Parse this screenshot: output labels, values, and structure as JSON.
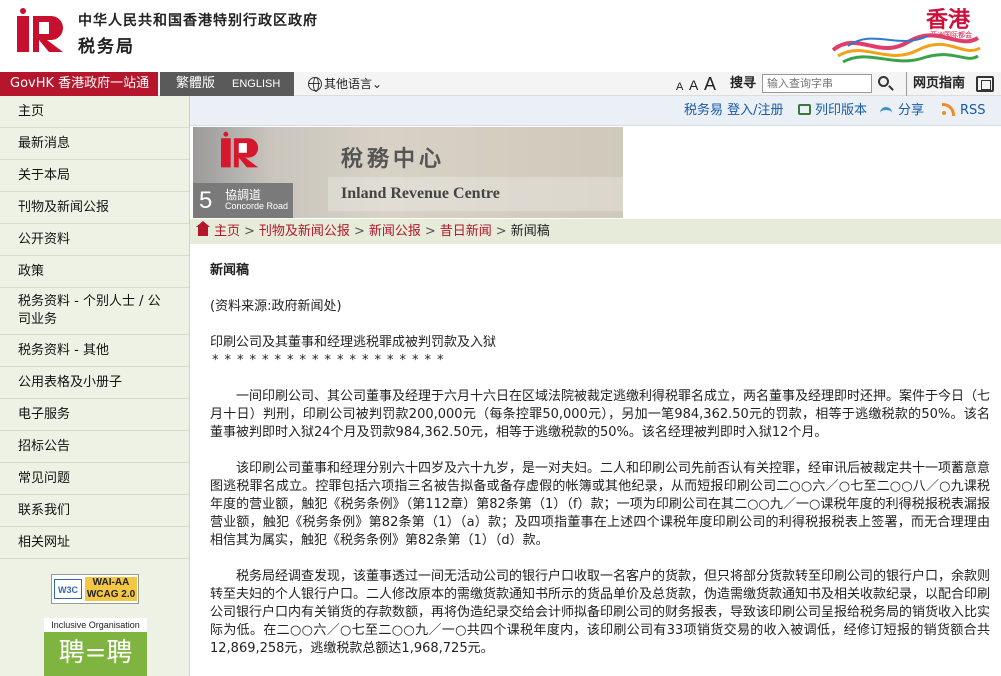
{
  "header": {
    "gov_name": "中华人民共和国香港特别行政区政府",
    "dept_name": "税务局",
    "brand_text": "香港",
    "brand_sub": "亚洲国际都会"
  },
  "topbar": {
    "govhk": "GovHK 香港政府一站通",
    "lang_tc": "繁體版",
    "lang_en": "ENGLISH",
    "other_lang": "其他语言",
    "font_sizes": [
      "A",
      "A",
      "A"
    ],
    "search_label": "搜寻",
    "search_placeholder": "输入查询字串",
    "sitemap": "网页指南"
  },
  "sidebar": {
    "items": [
      "主页",
      "最新消息",
      "关于本局",
      "刊物及新闻公报",
      "公开资料",
      "政策",
      "税务资料 - 个别人士 / 公司业务",
      "税务资料 - 其他",
      "公用表格及小册子",
      "电子服务",
      "招标公告",
      "常见问题",
      "联系我们",
      "相关网址"
    ],
    "wcag_w3c": "W3C",
    "wcag_label_1": "WAI-AA",
    "wcag_label_2": "WCAG 2.0",
    "inclusive_label": "Inclusive Organisation",
    "inclusive_glyph": "聘=聘"
  },
  "utilbar": {
    "etax": "税务易 登入/注册",
    "print": "列印版本",
    "share": "分享",
    "rss": "RSS"
  },
  "banner": {
    "number": "5",
    "road_cn": "協調道",
    "road_en": "Concorde Road",
    "building_cn": "稅務中心",
    "building_en": "Inland Revenue Centre"
  },
  "breadcrumb": {
    "items": [
      "主页",
      "刊物及新闻公报",
      "新闻公报",
      "昔日新闻"
    ],
    "current": "新闻稿",
    "separator": ">"
  },
  "content": {
    "title": "新闻稿",
    "source": "(资料来源:政府新闻处)",
    "headline": "印刷公司及其董事和经理逃税罪成被判罚款及入狱",
    "stars": "*******************",
    "paragraphs": [
      "一间印刷公司、其公司董事及经理于六月十六日在区域法院被裁定逃缴利得税罪名成立，两名董事及经理即时还押。案件于今日（七月十日）判刑，印刷公司被判罚款200,000元（每条控罪50,000元），另加一笔984,362.50元的罚款，相等于逃缴税款的50%。该名董事被判即时入狱24个月及罚款984,362.50元，相等于逃缴税款的50%。该名经理被判即时入狱12个月。",
      "该印刷公司董事和经理分别六十四岁及六十九岁，是一对夫妇。二人和印刷公司先前否认有关控罪，经审讯后被裁定共十一项蓄意意图逃税罪名成立。控罪包括六项指三名被告拟备或备存虚假的帐簿或其他纪录，从而短报印刷公司二○○六／○七至二○○八／○九课税年度的营业额，触犯《税务条例》（第112章）第82条第（1）（f）款；一项为印刷公司在其二○○九／一○课税年度的利得税报税表漏报营业额，触犯《税务条例》第82条第（1）（a）款；及四项指董事在上述四个课税年度印刷公司的利得税报税表上签署，而无合理理由相信其为属实，触犯《税务条例》第82条第（1）（d）款。",
      "税务局经调查发现，该董事透过一间无活动公司的银行户口收取一名客户的货款，但只将部分货款转至印刷公司的银行户口，余款则转至夫妇的个人银行户口。二人修改原本的需缴货款通知书所示的货品单价及总货款，伪造需缴货款通知书及相关收款纪录，以配合印刷公司银行户口内有关销货的存款数额，再将伪造纪录交给会计师拟备印刷公司的财务报表，导致该印刷公司呈报给税务局的销货收入比实际为低。在二○○六／○七至二○○九／一○共四个课税年度内，该印刷公司有33项销货交易的收入被调低，经修订短报的销货额合共12,869,258元，逃缴税款总额达1,968,725元。"
    ]
  }
}
